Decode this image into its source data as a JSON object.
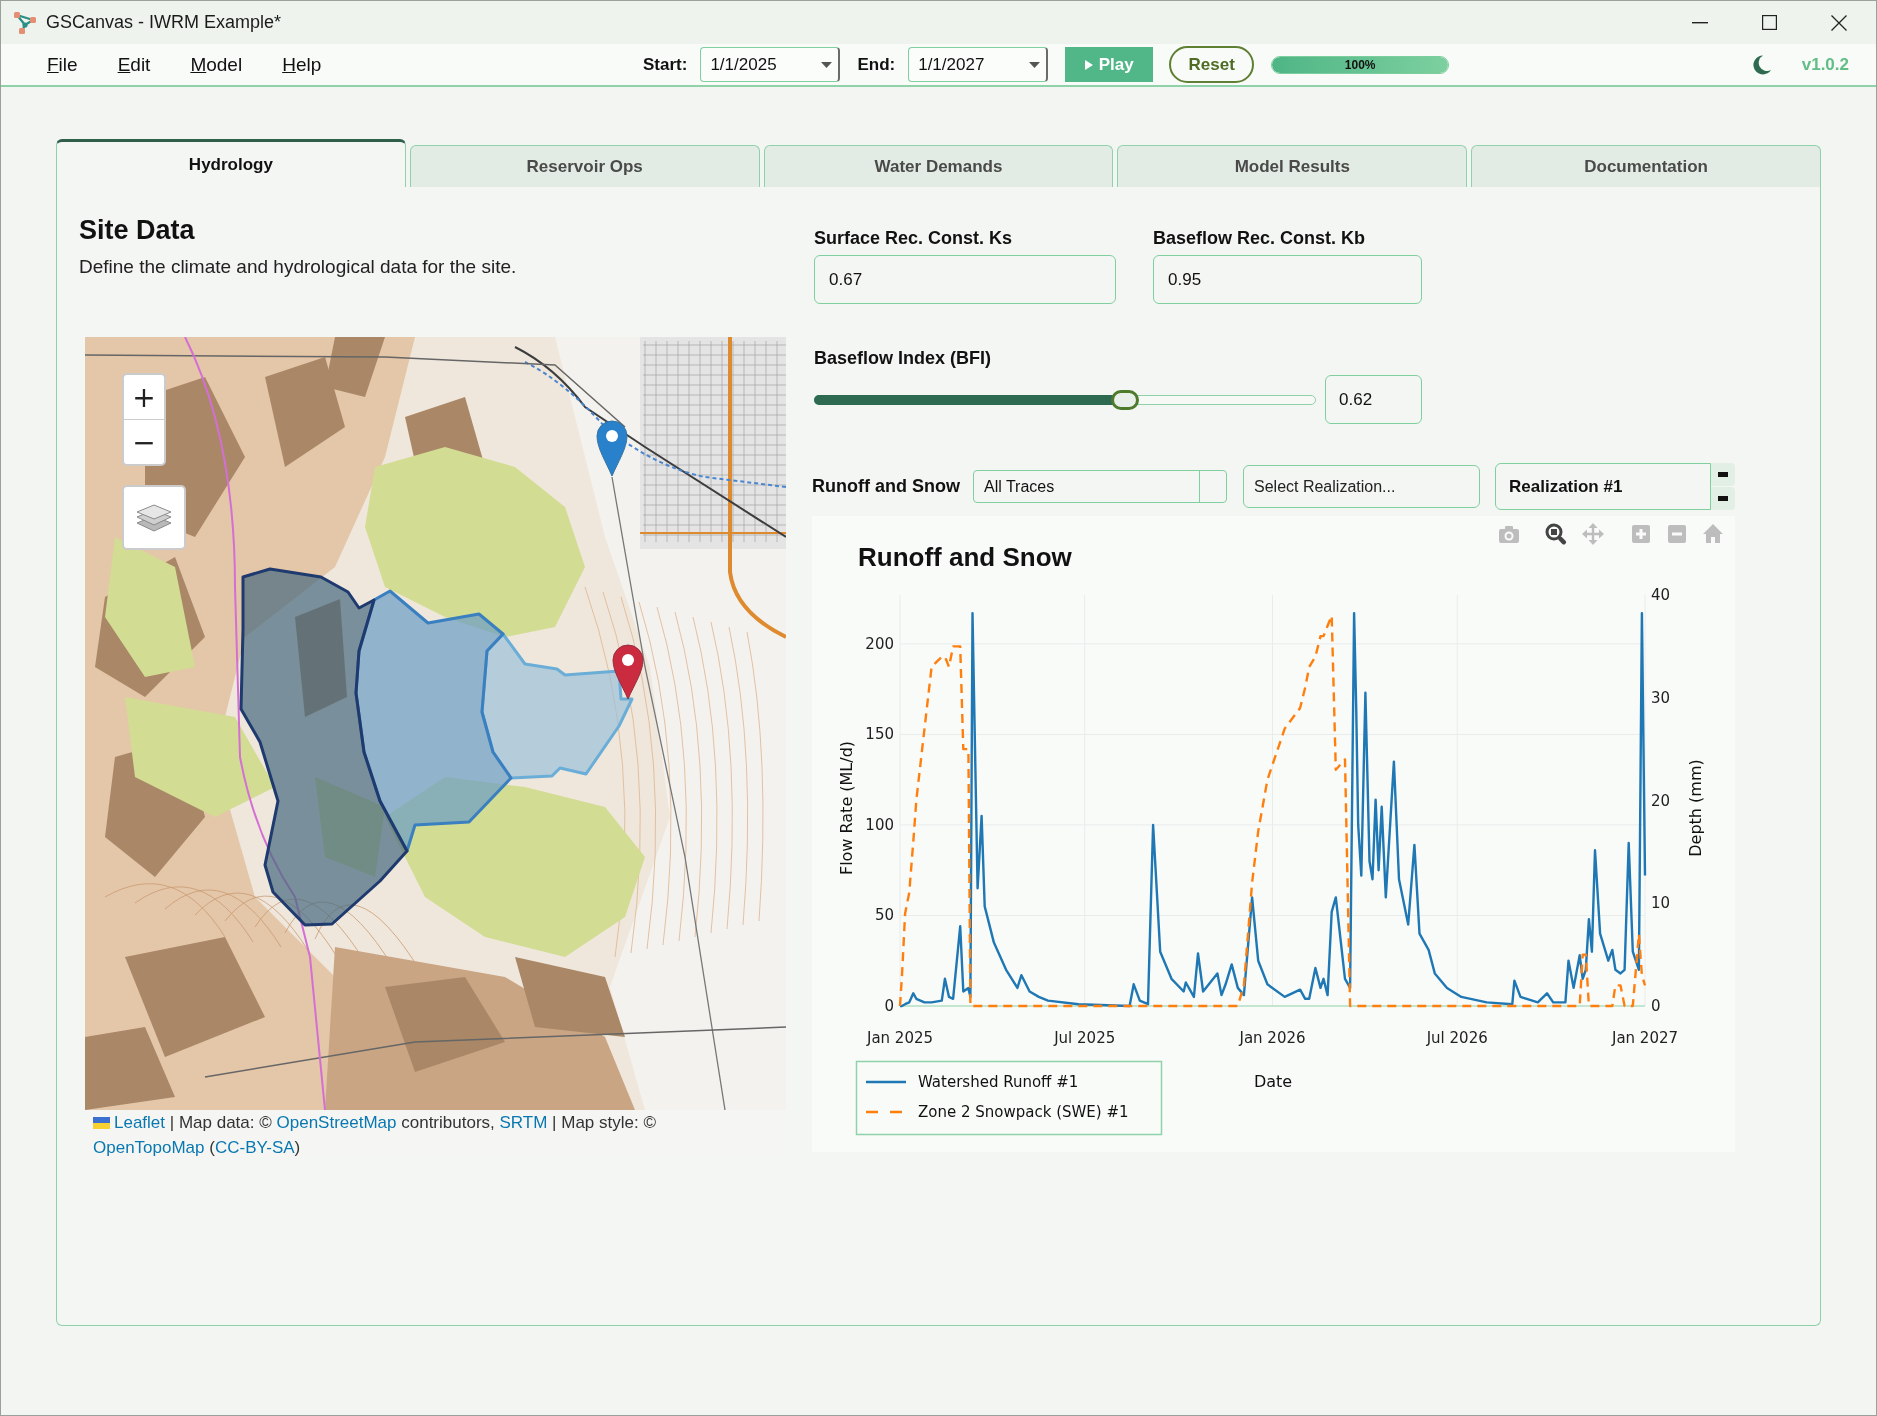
{
  "window": {
    "title": "GSCanvas - IWRM Example*"
  },
  "menu": [
    "File",
    "Edit",
    "Model",
    "Help"
  ],
  "toolbar": {
    "start": {
      "label": "Start:",
      "value": "1/1/2025"
    },
    "end": {
      "label": "End:",
      "value": "1/1/2027"
    },
    "play": "Play",
    "reset": "Reset",
    "progress": {
      "level": 1,
      "text": "100%"
    },
    "version": "v1.0.2"
  },
  "tabs": [
    {
      "label": "Hydrology",
      "selected": true
    },
    {
      "label": "Reservoir Ops",
      "selected": false
    },
    {
      "label": "Water Demands",
      "selected": false
    },
    {
      "label": "Model Results",
      "selected": false
    },
    {
      "label": "Documentation",
      "selected": false
    }
  ],
  "site_data": {
    "title": "Site Data",
    "description": "Define the climate and hydrological data for the site."
  },
  "map": {
    "zoom_in": "+",
    "zoom_out": "−",
    "attribution": [
      {
        "kind": "link",
        "text": "Leaflet"
      },
      {
        "kind": "plain",
        "text": " | Map data: © "
      },
      {
        "kind": "link",
        "text": "OpenStreetMap"
      },
      {
        "kind": "plain",
        "text": " contributors, "
      },
      {
        "kind": "link",
        "text": "SRTM"
      },
      {
        "kind": "plain",
        "text": " | Map style: © "
      },
      {
        "kind": "link",
        "text": "OpenTopoMap"
      },
      {
        "kind": "plain",
        "text": " ("
      },
      {
        "kind": "link",
        "text": "CC-BY-SA"
      },
      {
        "kind": "plain",
        "text": ")"
      }
    ]
  },
  "parameters": [
    {
      "label": "Surface Rec. Const. Ks",
      "value": "0.67"
    },
    {
      "label": "Baseflow Rec. Const. Kb",
      "value": "0.95"
    }
  ],
  "bfi": {
    "label": "Baseflow Index (BFI)",
    "level": 0.62,
    "value": "0.62"
  },
  "chart_controls": {
    "label": "Runoff and Snow",
    "trace_filter": "All Traces",
    "realization_select": {
      "placeholder": "Select Realization..."
    },
    "realization": "Realization #1"
  },
  "chart": {
    "modebar": [
      {
        "kind": "camera",
        "selected": false
      },
      {
        "kind": "zoom",
        "selected": true
      },
      {
        "kind": "pan",
        "selected": false
      },
      {
        "kind": "zoom_in",
        "selected": false
      },
      {
        "kind": "zoom_out",
        "selected": false
      },
      {
        "kind": "home",
        "selected": false
      }
    ],
    "chart_data": {
      "type": "line",
      "title": "Runoff and Snow",
      "xlabel": "Date",
      "ylabel": "Flow Rate (ML/d)",
      "y2label": "Depth (mm)",
      "grid": true,
      "legend": "bottom-left",
      "x": [
        "2025-01-01",
        "2025-01-03",
        "2025-01-06",
        "2025-01-10",
        "2025-01-14",
        "2025-01-17",
        "2025-01-25",
        "2025-02-01",
        "2025-02-11",
        "2025-02-14",
        "2025-02-18",
        "2025-02-22",
        "2025-03-01",
        "2025-03-04",
        "2025-03-09",
        "2025-03-11",
        "2025-03-13",
        "2025-03-18",
        "2025-03-22",
        "2025-03-25",
        "2025-04-03",
        "2025-04-15",
        "2025-04-26",
        "2025-04-30",
        "2025-05-08",
        "2025-05-17",
        "2025-05-26",
        "2025-06-25",
        "2025-08-14",
        "2025-08-18",
        "2025-08-24",
        "2025-09-01",
        "2025-09-06",
        "2025-09-13",
        "2025-09-24",
        "2025-10-06",
        "2025-10-08",
        "2025-10-16",
        "2025-10-20",
        "2025-10-25",
        "2025-11-08",
        "2025-11-12",
        "2025-11-16",
        "2025-11-22",
        "2025-11-28",
        "2025-12-04",
        "2025-12-12",
        "2025-12-18",
        "2025-12-27",
        "2026-01-13",
        "2026-01-28",
        "2026-02-02",
        "2026-02-06",
        "2026-02-12",
        "2026-02-17",
        "2026-02-20",
        "2026-02-24",
        "2026-02-28",
        "2026-03-04",
        "2026-03-13",
        "2026-03-18",
        "2026-03-22",
        "2026-03-24",
        "2026-03-26",
        "2026-03-29",
        "2026-04-02",
        "2026-04-06",
        "2026-04-09",
        "2026-04-12",
        "2026-04-15",
        "2026-04-18",
        "2026-04-22",
        "2026-04-30",
        "2026-05-05",
        "2026-05-14",
        "2026-05-20",
        "2026-05-25",
        "2026-06-03",
        "2026-06-09",
        "2026-06-21",
        "2026-07-05",
        "2026-07-30",
        "2026-08-24",
        "2026-08-26",
        "2026-09-01",
        "2026-09-18",
        "2026-09-27",
        "2026-10-03",
        "2026-10-15",
        "2026-10-18",
        "2026-10-23",
        "2026-10-29",
        "2026-11-01",
        "2026-11-04",
        "2026-11-07",
        "2026-11-10",
        "2026-11-13",
        "2026-11-18",
        "2026-11-26",
        "2026-11-30",
        "2026-12-03",
        "2026-12-08",
        "2026-12-12",
        "2026-12-16",
        "2026-12-20",
        "2026-12-26",
        "2026-12-29",
        "2027-01-01"
      ],
      "xlim": [
        "2025-01-01",
        "2027-01-01"
      ],
      "ylim": [
        0,
        227
      ],
      "y2lim": [
        0,
        40
      ],
      "xticks": [
        {
          "value": "2025-01-01",
          "label": "Jan 2025"
        },
        {
          "value": "2025-07-01",
          "label": "Jul 2025"
        },
        {
          "value": "2026-01-01",
          "label": "Jan 2026"
        },
        {
          "value": "2026-07-01",
          "label": "Jul 2026"
        },
        {
          "value": "2027-01-01",
          "label": "Jan 2027"
        }
      ],
      "yticks": [
        0,
        50,
        100,
        150,
        200
      ],
      "y2ticks": [
        0,
        10,
        20,
        30,
        40
      ],
      "series": [
        {
          "name": "Watershed Runoff #1",
          "color": "#1f77b4",
          "line_style": "solid",
          "values": [
            0,
            0,
            1,
            2,
            7,
            4,
            2,
            2,
            3,
            15,
            5,
            4,
            44,
            8,
            10,
            5,
            217,
            65,
            105,
            55,
            35,
            20,
            10,
            17,
            8,
            5,
            3,
            1,
            0,
            12,
            3,
            1,
            100,
            30,
            15,
            8,
            13,
            5,
            29,
            8,
            18,
            6,
            12,
            23,
            10,
            6,
            60,
            25,
            12,
            5,
            9,
            4,
            4,
            21,
            10,
            15,
            6,
            52,
            60,
            15,
            10,
            217,
            165,
            100,
            72,
            173,
            80,
            70,
            114,
            75,
            110,
            60,
            135,
            70,
            45,
            89,
            40,
            31,
            18,
            10,
            5,
            2,
            1,
            14,
            5,
            2,
            7,
            2,
            2,
            25,
            10,
            28,
            15,
            20,
            48,
            30,
            86,
            40,
            25,
            31,
            20,
            18,
            20,
            90,
            30,
            20,
            217,
            72
          ]
        },
        {
          "name": "Zone 2 Snowpack (SWE) #1",
          "color": "#ff7f0e",
          "axis": "y2",
          "line_style": "dashed",
          "values": [
            0,
            3,
            9,
            11,
            16,
            20,
            27,
            33,
            34,
            34,
            33,
            35,
            35,
            25,
            25,
            0,
            0,
            0,
            0,
            0,
            0,
            0,
            0,
            0,
            0,
            0,
            0,
            0,
            0,
            0,
            0,
            0,
            0,
            0,
            0,
            0,
            0,
            0,
            0,
            0,
            0,
            0,
            0,
            0,
            0,
            2,
            12,
            17,
            22,
            27,
            29,
            31,
            33,
            34,
            36,
            36,
            37,
            38,
            23,
            24,
            0,
            0,
            0,
            0,
            0,
            0,
            0,
            0,
            0,
            0,
            0,
            0,
            0,
            0,
            0,
            0,
            0,
            0,
            0,
            0,
            0,
            0,
            0,
            0,
            0,
            0,
            0,
            0,
            0,
            0,
            0,
            0,
            5,
            5,
            0,
            0,
            0,
            0,
            0,
            0,
            2,
            2,
            0,
            0,
            0,
            7,
            3,
            2
          ]
        }
      ]
    }
  }
}
